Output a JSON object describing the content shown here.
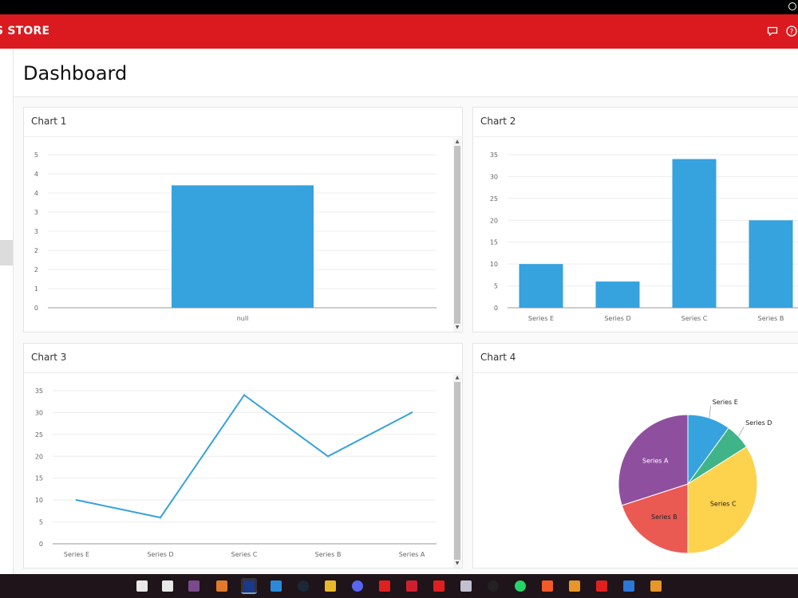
{
  "app": {
    "title": "S STORE"
  },
  "header": {
    "chat_icon": "chat-bubble-icon",
    "help_icon": "help-circle-icon"
  },
  "page": {
    "title": "Dashboard"
  },
  "charts": {
    "chart1": {
      "title": "Chart 1"
    },
    "chart2": {
      "title": "Chart 2"
    },
    "chart3": {
      "title": "Chart 3"
    },
    "chart4": {
      "title": "Chart 4"
    }
  },
  "chart_data": [
    {
      "type": "bar",
      "categories": [
        "null"
      ],
      "values": [
        4
      ],
      "ylim": [
        0,
        5
      ],
      "yticks": [
        "0",
        "1",
        "2",
        "2",
        "3",
        "3",
        "4",
        "4",
        "5"
      ],
      "grid": true
    },
    {
      "type": "bar",
      "categories": [
        "Series E",
        "Series D",
        "Series C",
        "Series B"
      ],
      "values": [
        10,
        6,
        34,
        20
      ],
      "ylim": [
        0,
        35
      ],
      "yticks": [
        0,
        5,
        10,
        15,
        20,
        25,
        30,
        35
      ],
      "grid": true
    },
    {
      "type": "line",
      "categories": [
        "Series E",
        "Series D",
        "Series C",
        "Series B",
        "Series A"
      ],
      "values": [
        10,
        6,
        34,
        20,
        30
      ],
      "ylim": [
        0,
        35
      ],
      "yticks": [
        0,
        5,
        10,
        15,
        20,
        25,
        30,
        35
      ],
      "grid": true
    },
    {
      "type": "pie",
      "labels": [
        "Series E",
        "Series D",
        "Series C",
        "Series B",
        "Series A"
      ],
      "values": [
        10,
        6,
        34,
        20,
        30
      ],
      "colors": [
        "#36a2de",
        "#3fb488",
        "#fdd24d",
        "#ea5a53",
        "#8e4f9f"
      ]
    }
  ],
  "colors": {
    "accent": "#da1a1f",
    "bar": "#36a2de",
    "line": "#36a2de"
  },
  "taskbar": {
    "icons": [
      "store-icon",
      "mail-icon",
      "media-player-icon",
      "game-icon",
      "app-icon",
      "edge-browser-icon",
      "steam-icon",
      "file-explorer-icon",
      "discord-icon",
      "app-red-icon",
      "app-red2-icon",
      "app-red3-icon",
      "cloud-app-icon",
      "obs-icon",
      "whatsapp-icon",
      "brave-browser-icon",
      "app-orange-icon",
      "app-red4-icon",
      "app-blue-icon",
      "app-orange2-icon"
    ]
  }
}
